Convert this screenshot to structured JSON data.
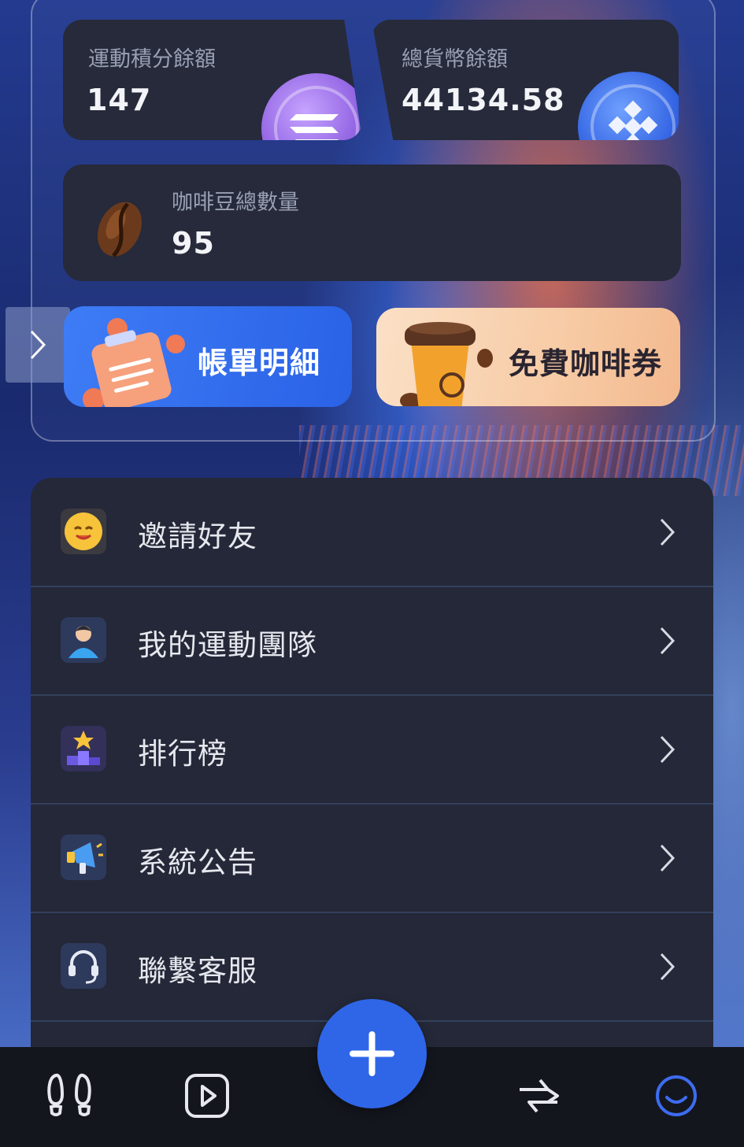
{
  "stats": {
    "sport_points": {
      "label": "運動積分餘額",
      "value": "147"
    },
    "total_currency": {
      "label": "總貨幣餘額",
      "value": "44134.58"
    },
    "coffee_beans": {
      "label": "咖啡豆總數量",
      "value": "95"
    }
  },
  "actions": {
    "bill_details": "帳單明細",
    "free_coffee_voucher": "免費咖啡券"
  },
  "menu": {
    "items": [
      {
        "label": "邀請好友",
        "icon": "smile-emoji-icon"
      },
      {
        "label": "我的運動團隊",
        "icon": "user-icon"
      },
      {
        "label": "排行榜",
        "icon": "podium-star-icon"
      },
      {
        "label": "系統公告",
        "icon": "megaphone-icon"
      },
      {
        "label": "聯繫客服",
        "icon": "headset-icon"
      }
    ]
  },
  "tabbar": {
    "items": [
      "footsteps-icon",
      "play-icon",
      "add-icon",
      "swap-icon",
      "profile-smile-icon"
    ],
    "active": "profile-smile-icon"
  },
  "colors": {
    "accent_blue": "#2f66e8",
    "card_bg": "#262a3a",
    "menu_bg": "#242838",
    "tab_active": "#3d6cf0"
  }
}
